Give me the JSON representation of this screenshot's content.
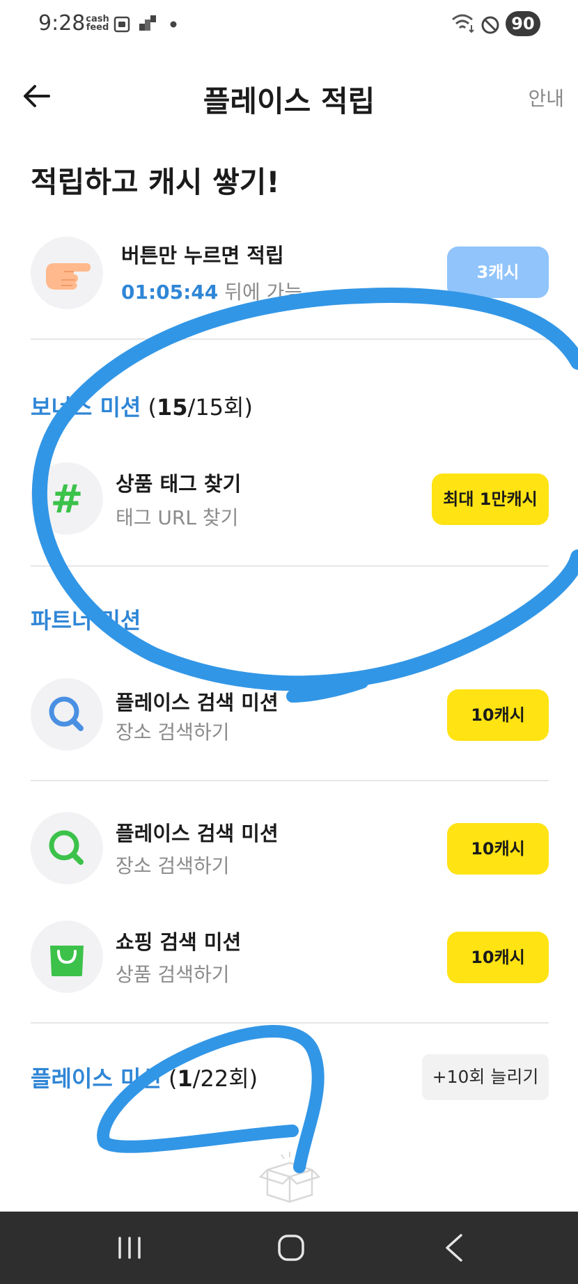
{
  "status_bar": {
    "time": "9:28",
    "cashfeed_line1": "cash",
    "cashfeed_line2": "feed",
    "battery": "90"
  },
  "header": {
    "title": "플레이스 적립",
    "guide_label": "안내"
  },
  "headline": "적립하고 캐시 쌓기!",
  "daily": {
    "icon": "pointing-hand-icon",
    "title": "버튼만 누르면 적립",
    "timer": "01:05:44",
    "timer_suffix": " 뒤에 가능",
    "reward": "3캐시"
  },
  "bonus_section": {
    "title": "보너스 미션",
    "count_open": " (",
    "count_done": "15",
    "count_rest": "/15회)"
  },
  "bonus_item": {
    "icon": "hashtag-icon",
    "title": "상품 태그 찾기",
    "subtitle": "태그 URL 찾기",
    "reward": "최대 1만캐시"
  },
  "partner_section": {
    "title": "파트너 미션"
  },
  "partner_items": [
    {
      "icon": "search-icon",
      "title": "플레이스 검색 미션",
      "subtitle": "장소 검색하기",
      "reward": "10캐시",
      "icon_color": "#4a90e2"
    },
    {
      "icon": "search-icon",
      "title": "플레이스 검색 미션",
      "subtitle": "장소 검색하기",
      "reward": "10캐시",
      "icon_color": "#3cc24a"
    },
    {
      "icon": "shopping-bag-icon",
      "title": "쇼핑 검색 미션",
      "subtitle": "상품 검색하기",
      "reward": "10캐시",
      "icon_color": "#3cc24a"
    }
  ],
  "place_section": {
    "title": "플레이스 미션",
    "count_open": " (",
    "count_done": "1",
    "count_rest": "/22회)",
    "increase_label": "+10회 늘리기"
  },
  "empty_state_icon": "open-box-icon",
  "colors": {
    "accent_blue": "#2f86d6",
    "reward_yellow": "#ffe312",
    "reward_blue": "#90c4fb",
    "annotation_blue": "#3296e6"
  }
}
